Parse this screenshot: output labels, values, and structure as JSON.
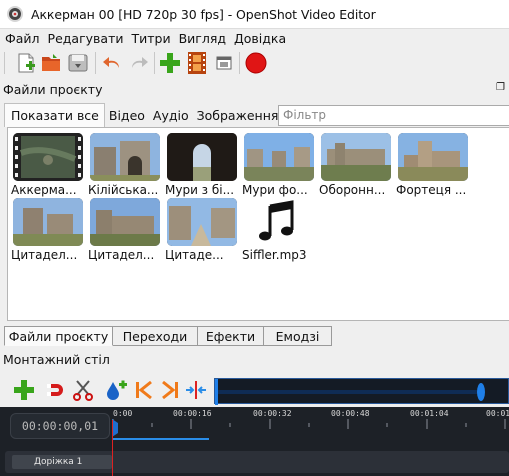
{
  "window": {
    "title": "Аккерман 00 [HD 720p 30 fps] - OpenShot Video Editor"
  },
  "menu": [
    "Файл",
    "Редагувати",
    "Титри",
    "Вигляд",
    "Довідка"
  ],
  "toolbar_icons": [
    "new-project-icon",
    "open-project-icon",
    "save-project-icon",
    "undo-icon",
    "redo-icon",
    "import-files-icon",
    "profile-film-icon",
    "fullscreen-icon",
    "record-icon"
  ],
  "files_panel": {
    "title": "Файли проєкту",
    "filter_tabs": [
      "Показати все",
      "Відео",
      "Аудіо",
      "Зображення"
    ],
    "filter_placeholder": "Фільтр",
    "items": [
      {
        "label": "Аккерма...",
        "kind": "video"
      },
      {
        "label": "Кілійська...",
        "kind": "image"
      },
      {
        "label": "Мури з бі...",
        "kind": "image"
      },
      {
        "label": "Мури фо...",
        "kind": "image"
      },
      {
        "label": "Оборонн...",
        "kind": "image"
      },
      {
        "label": "Фортеця ...",
        "kind": "image"
      },
      {
        "label": "Цитадел...",
        "kind": "image"
      },
      {
        "label": "Цитадел...",
        "kind": "image"
      },
      {
        "label": "Цитаде...",
        "kind": "image"
      },
      {
        "label": "Siffler.mp3",
        "kind": "audio"
      }
    ]
  },
  "bottom_tabs": [
    "Файли проєкту",
    "Переходи",
    "Ефекти",
    "Емодзі"
  ],
  "timeline": {
    "title": "Монтажний стіл",
    "timecode": "00:00:00,01",
    "ruler": [
      "0:00",
      "00:00:16",
      "00:00:32",
      "00:00:48",
      "00:01:04",
      "00:01:"
    ],
    "track_name": "Доріжка 1",
    "tools": [
      "add-track-icon",
      "snap-icon",
      "razor-icon",
      "add-marker-icon",
      "previous-marker-icon",
      "next-marker-icon",
      "center-playhead-icon"
    ]
  }
}
